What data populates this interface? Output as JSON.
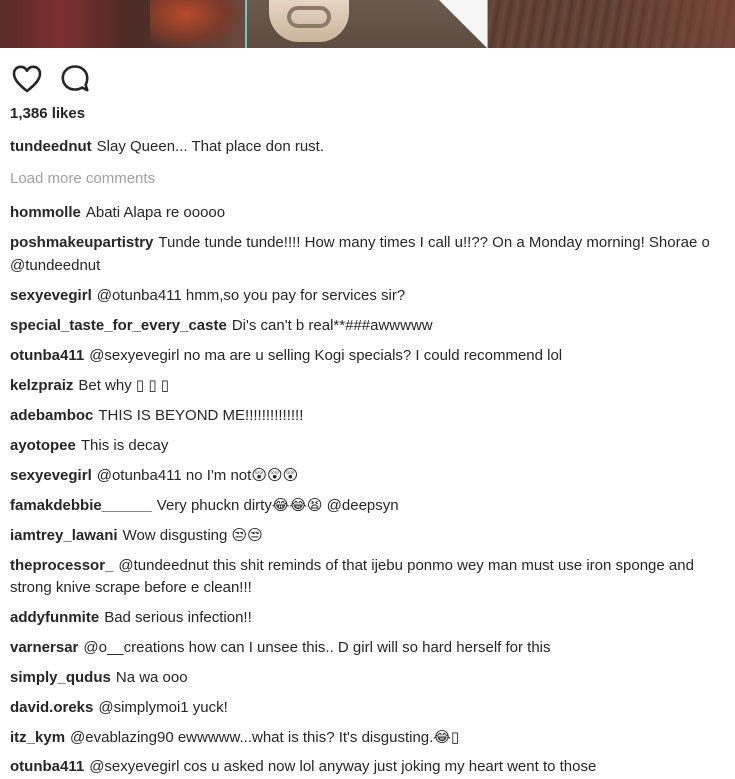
{
  "post": {
    "likes_text": "1,386 likes",
    "caption": {
      "username": "tundeednut",
      "text": "Slay Queen... That place don rust."
    },
    "load_more_label": "Load more comments",
    "actions": [
      {
        "icon": "heart-icon"
      },
      {
        "icon": "comment-icon"
      }
    ]
  },
  "comments": [
    {
      "username": "hommolle",
      "text": "Abati Alapa re ooooo"
    },
    {
      "username": "poshmakeupartistry",
      "text": "Tunde tunde tunde!!!! How many times I call u!!?? On a Monday morning! Shorae o @tundeednut"
    },
    {
      "username": "sexyevegirl",
      "text": "@otunba411 hmm,so you pay for services sir?"
    },
    {
      "username": "special_taste_for_every_caste",
      "text": "Di's can't b real**###awwwww"
    },
    {
      "username": "otunba411",
      "text": "@sexyevegirl no ma are u selling Kogi specials? I could recommend lol"
    },
    {
      "username": "kelzpraiz",
      "text": "Bet why ▯ ▯ ▯"
    },
    {
      "username": "adebamboc",
      "text": "THIS IS BEYOND ME!!!!!!!!!!!!!!"
    },
    {
      "username": "ayotopee",
      "text": "This is decay"
    },
    {
      "username": "sexyevegirl",
      "text": "@otunba411 no I'm not😲😲😲"
    },
    {
      "username": "famakdebbie______",
      "text": "Very phuckn dirty😂😂😫 @deepsyn"
    },
    {
      "username": "iamtrey_lawani",
      "text": "Wow disgusting 😒😒"
    },
    {
      "username": "theprocessor_",
      "text": "@tundeednut this shit reminds of that ijebu ponmo wey man must use iron sponge and strong knive scrape before e clean!!!"
    },
    {
      "username": "addyfunmite",
      "text": "Bad serious infection!!"
    },
    {
      "username": "varnersar",
      "text": "@o__creations how can I unsee this.. D girl will so hard herself for this"
    },
    {
      "username": "simply_qudus",
      "text": "Na wa ooo"
    },
    {
      "username": "david.oreks",
      "text": "@simplymoi1 yuck!"
    },
    {
      "username": "itz_kym",
      "text": "@evablazing90 ewwwww...what is this? It's disgusting.😂▯"
    },
    {
      "username": "otunba411",
      "text": "@sexyevegirl cos u asked now lol anyway just joking my heart went to those"
    }
  ]
}
